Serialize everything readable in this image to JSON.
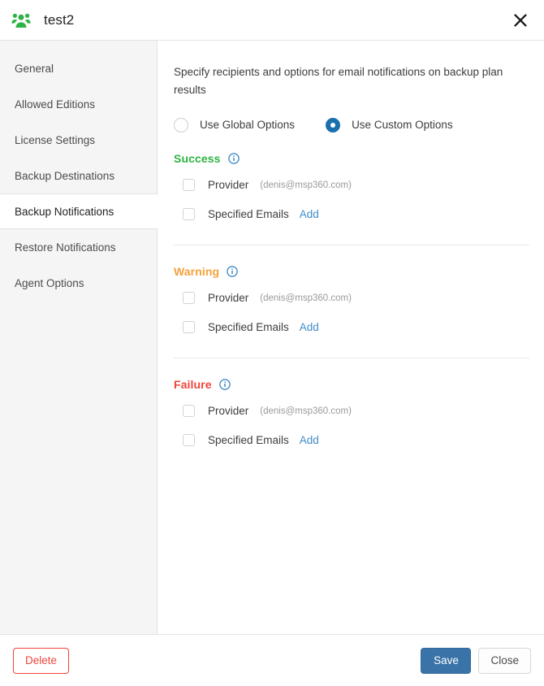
{
  "window": {
    "title": "test2",
    "icon": "users-group-icon",
    "icon_color": "#2fb344",
    "close_icon": "close-x-icon"
  },
  "sidebar": {
    "items": [
      {
        "label": "General",
        "active": false
      },
      {
        "label": "Allowed Editions",
        "active": false
      },
      {
        "label": "License Settings",
        "active": false
      },
      {
        "label": "Backup Destinations",
        "active": false
      },
      {
        "label": "Backup Notifications",
        "active": true
      },
      {
        "label": "Restore Notifications",
        "active": false
      },
      {
        "label": "Agent Options",
        "active": false
      }
    ]
  },
  "main": {
    "description": "Specify recipients and options for email notifications on backup plan results",
    "options_mode": {
      "selected": "Use Custom Options",
      "choices": [
        {
          "label": "Use Global Options",
          "selected": false
        },
        {
          "label": "Use Custom Options",
          "selected": true
        }
      ]
    },
    "sections": [
      {
        "title": "Success",
        "color": "#2fb344",
        "info_icon": "info-circle-icon",
        "rows": [
          {
            "label": "Provider",
            "sub": "(denis@msp360.com)",
            "checked": false,
            "link": ""
          },
          {
            "label": "Specified Emails",
            "sub": "",
            "checked": false,
            "link": "Add"
          }
        ]
      },
      {
        "title": "Warning",
        "color": "#f6a23c",
        "info_icon": "info-circle-icon",
        "rows": [
          {
            "label": "Provider",
            "sub": "(denis@msp360.com)",
            "checked": false,
            "link": ""
          },
          {
            "label": "Specified Emails",
            "sub": "",
            "checked": false,
            "link": "Add"
          }
        ]
      },
      {
        "title": "Failure",
        "color": "#f0453a",
        "info_icon": "info-circle-icon",
        "rows": [
          {
            "label": "Provider",
            "sub": "(denis@msp360.com)",
            "checked": false,
            "link": ""
          },
          {
            "label": "Specified Emails",
            "sub": "",
            "checked": false,
            "link": "Add"
          }
        ]
      }
    ]
  },
  "footer": {
    "delete_label": "Delete",
    "save_label": "Save",
    "close_label": "Close"
  }
}
